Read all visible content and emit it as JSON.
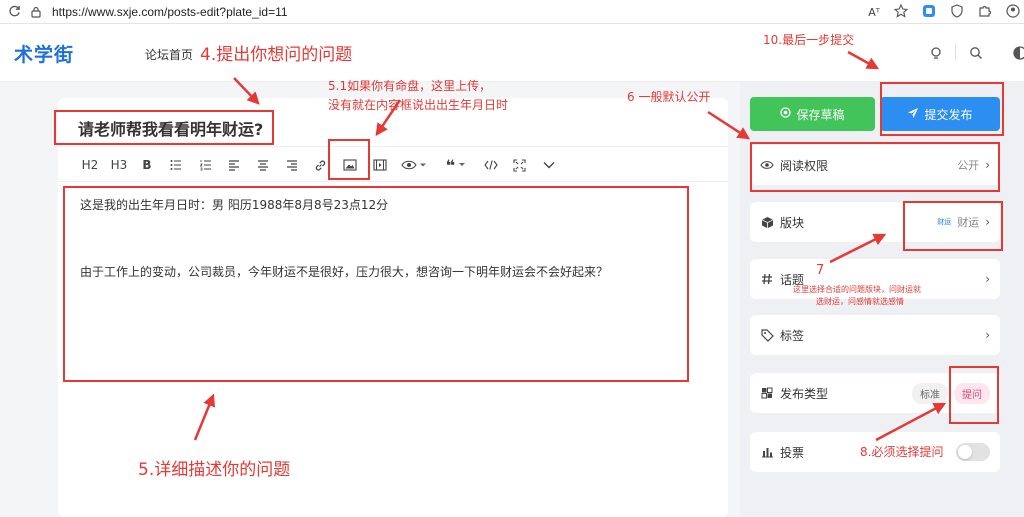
{
  "browser": {
    "url": "https://www.sxje.com/posts-edit?plate_id=11",
    "reader_label": "Aᵀ"
  },
  "header": {
    "logo": "术学街",
    "nav_home": "论坛首页"
  },
  "editor": {
    "title": "请老师帮我看看明年财运?",
    "toolbar": {
      "h2": "H2",
      "h3": "H3",
      "bold": "B",
      "quote": "❝"
    },
    "content": [
      "这是我的出生年月日时：男  阳历1988年8月8号23点12分",
      "由于工作上的变动，公司裁员，今年财运不是很好，压力很大，想咨询一下明年财运会不会好起来？"
    ]
  },
  "sidebar": {
    "save_draft": "保存草稿",
    "submit": "提交发布",
    "read_permission": {
      "label": "阅读权限",
      "value": "公开"
    },
    "section": {
      "label": "版块",
      "tag": "财运",
      "value": "财运"
    },
    "topic": {
      "label": "话题"
    },
    "tags": {
      "label": "标签"
    },
    "post_type": {
      "label": "发布类型",
      "option_standard": "标准",
      "option_ask": "提问"
    },
    "vote": {
      "label": "投票"
    }
  },
  "annotations": {
    "a4": "4.提出你想问的问题",
    "a51_line1": "5.1如果你有命盘，这里上传，",
    "a51_line2": "没有就在内容框说出出生年月日时",
    "a5": "5.详细描述你的问题",
    "a6": "6  一般默认公开",
    "a7": "7",
    "a7_note_line1": "这里选择合适的问题版块，问财运就",
    "a7_note_line2": "选财运，问感情就选感情",
    "a8": "8.必须选择提问",
    "a10": "10.最后一步提交"
  },
  "colors": {
    "annotation": "#e53935",
    "brand": "#1d6fd9",
    "save": "#43c45b",
    "submit": "#2b8ef0"
  }
}
